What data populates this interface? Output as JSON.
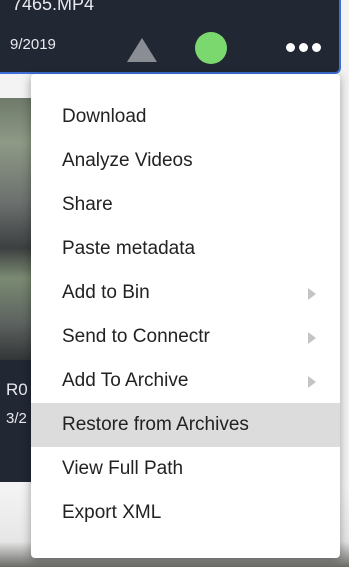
{
  "card_top": {
    "filename": "7465.MP4",
    "date": "9/2019"
  },
  "card_mid": {
    "line1": "R0",
    "line2": "3/2"
  },
  "menu": {
    "items": [
      {
        "label": "Download",
        "has_submenu": false
      },
      {
        "label": "Analyze Videos",
        "has_submenu": false
      },
      {
        "label": "Share",
        "has_submenu": false
      },
      {
        "label": "Paste metadata",
        "has_submenu": false
      },
      {
        "label": "Add to Bin",
        "has_submenu": true
      },
      {
        "label": "Send to Connectr",
        "has_submenu": true
      },
      {
        "label": "Add To Archive",
        "has_submenu": true
      },
      {
        "label": "Restore from Archives",
        "has_submenu": false,
        "highlighted": true
      },
      {
        "label": "View Full Path",
        "has_submenu": false
      },
      {
        "label": "Export XML",
        "has_submenu": false
      }
    ]
  },
  "icons": [
    "warning-triangle-icon",
    "status-dot-icon",
    "more-options-icon",
    "submenu-arrow-icon"
  ],
  "colors": {
    "card_bg": "#222734",
    "card_border": "#3e6fd8",
    "status_green": "#7bd86e",
    "triangle_gray": "#8a8d94",
    "highlight": "#dcdcdc"
  }
}
